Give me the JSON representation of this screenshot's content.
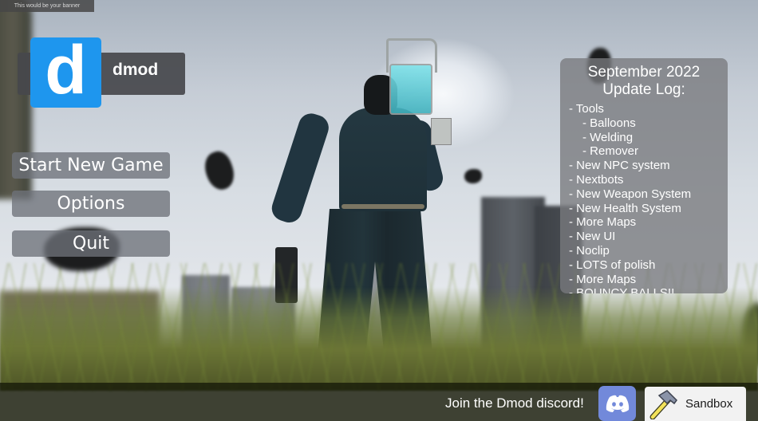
{
  "banner": {
    "text": "This would be your banner"
  },
  "logo": {
    "letter": "d",
    "name": "dmod",
    "brand_color": "#1e96ee"
  },
  "main_menu": {
    "items": [
      {
        "label": "Start New Game"
      },
      {
        "label": "Options"
      },
      {
        "label": "Quit"
      }
    ]
  },
  "update_log": {
    "title_line1": "September 2022",
    "title_line2": "Update Log:",
    "entries": [
      {
        "text": "- Tools",
        "sub": false
      },
      {
        "text": "- Balloons",
        "sub": true
      },
      {
        "text": "- Welding",
        "sub": true
      },
      {
        "text": "- Remover",
        "sub": true
      },
      {
        "text": "- New NPC system",
        "sub": false
      },
      {
        "text": "- Nextbots",
        "sub": false
      },
      {
        "text": "- New Weapon System",
        "sub": false
      },
      {
        "text": "- New Health System",
        "sub": false
      },
      {
        "text": "- More Maps",
        "sub": false
      },
      {
        "text": "- New UI",
        "sub": false
      },
      {
        "text": "- Noclip",
        "sub": false
      },
      {
        "text": "- LOTS of polish",
        "sub": false
      },
      {
        "text": "- More Maps",
        "sub": false
      },
      {
        "text": "- BOUNCY BALLS!!",
        "sub": false
      }
    ]
  },
  "bottom_bar": {
    "discord_prompt": "Join the Dmod discord!",
    "discord_icon": "discord-logo",
    "discord_color": "#7289da",
    "sandbox_label": "Sandbox",
    "sandbox_icon": "hammer"
  }
}
